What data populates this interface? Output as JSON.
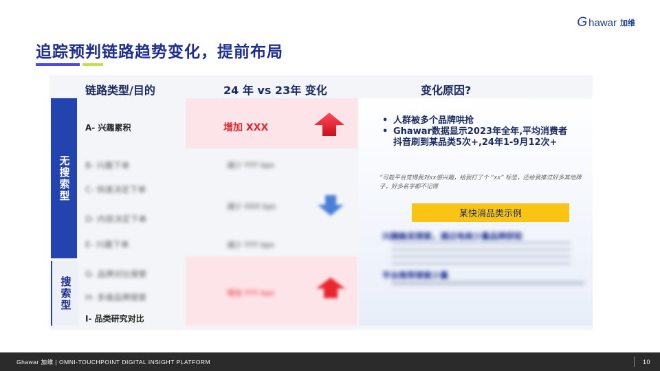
{
  "logo": {
    "g": "G",
    "text": "hawar",
    "cn": "加维"
  },
  "title": "追踪预判链路趋势变化，提前布局",
  "headers": {
    "col1": "链路类型/目的",
    "col2": "24 年 vs 23年 变化",
    "col3": "变化原因?"
  },
  "side": {
    "top": "无搜索型",
    "bottom": "搜索型"
  },
  "rows": {
    "a": "A- 兴趣累积",
    "b": "B- 兴趣下单",
    "c": "C- 快速决定下单",
    "d": "D- 内容决定下单",
    "e": "E- 兴趣下单",
    "f": "G- 品牌对比搜索",
    "g": "H- 多维品牌搜索",
    "i": "I- 品类研究对比"
  },
  "changes": {
    "a": "增加 XXX",
    "b": "减少 YYY bps",
    "d": "减少 XXX bps",
    "e": "减少 YYY bps",
    "g": "增加 YYY bps"
  },
  "reasons": {
    "bullet1": "人群被多个品牌哄抢",
    "bullet2": "Ghawar数据显示2023年全年,平均消费者抖音刷到某品类5次+,24年1-9月12次+",
    "quote": "“可能平台觉得我对xx感兴趣，给我打了个 “xx” 标签，还给我推过好多其他牌子，好多名字都不记得",
    "tag": "某快消品类示例",
    "blur1": "兴趣触发搜索，通过电商少量品牌获取",
    "blur2": "平台推荐搜索少量"
  },
  "footer": {
    "text": "Ghawar 加维 | OMNI-TOUCHPOINT DIGITAL INSIGHT PLATFORM",
    "page": "10"
  },
  "colors": {
    "accent": "#1d2e8f",
    "side": "#2343ae",
    "up": "#e8262f",
    "down": "#4a7fd8",
    "tag": "#f9c414"
  }
}
